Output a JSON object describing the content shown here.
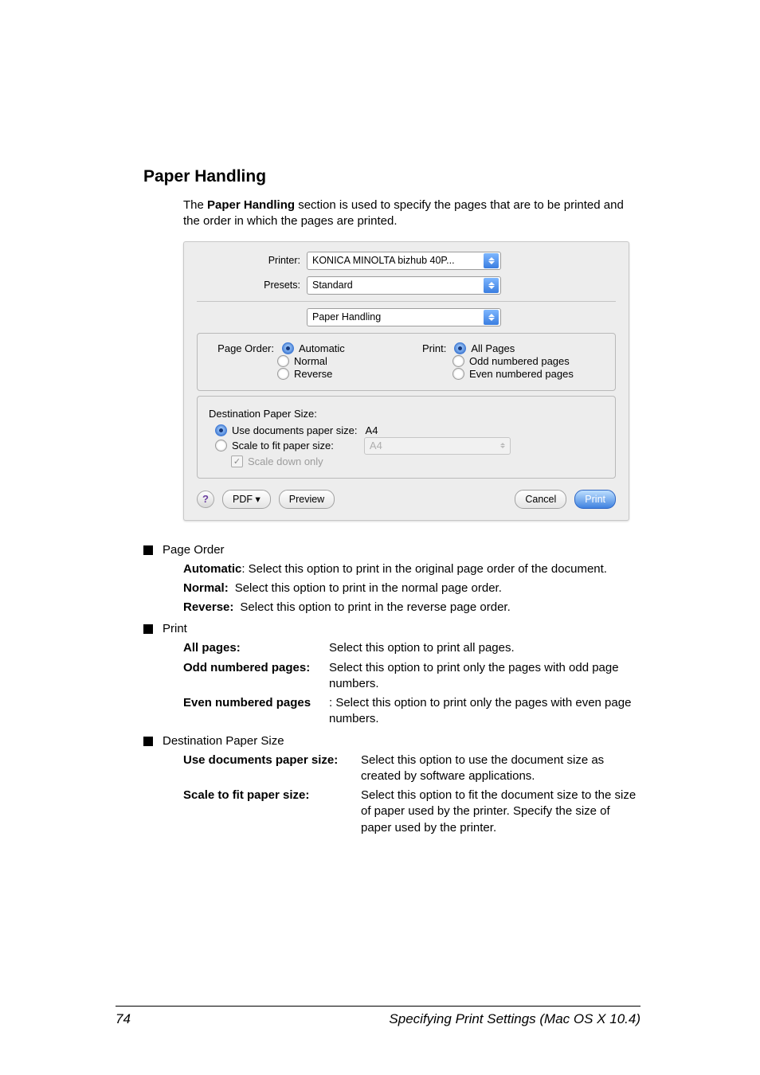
{
  "title": "Paper Handling",
  "intro_a": "The ",
  "intro_b": "Paper Handling",
  "intro_c": " section is used to specify the pages that are to be printed and the order in which the pages are printed.",
  "dialog": {
    "printer_label": "Printer:",
    "printer_value": "KONICA MINOLTA bizhub 40P...",
    "presets_label": "Presets:",
    "presets_value": "Standard",
    "section_value": "Paper Handling",
    "page_order_label": "Page Order:",
    "po_automatic": "Automatic",
    "po_normal": "Normal",
    "po_reverse": "Reverse",
    "print_label": "Print:",
    "pr_all": "All Pages",
    "pr_odd": "Odd numbered pages",
    "pr_even": "Even numbered pages",
    "dps_title": "Destination Paper Size:",
    "dps_use_label": "Use documents paper size:",
    "dps_use_value": "A4",
    "dps_scale_label": "Scale to fit paper size:",
    "dps_scale_value": "A4",
    "dps_scaledown": "Scale down only",
    "help_symbol": "?",
    "pdf_label": "PDF ▾",
    "preview_label": "Preview",
    "cancel_label": "Cancel",
    "print_btn_label": "Print"
  },
  "sections": {
    "page_order": {
      "title": "Page Order",
      "automatic_label": "Automatic",
      "automatic_text": ": Select this option to print in the original page order of the document.",
      "normal_label": "Normal",
      "normal_text": "Select this option to print in the normal page order.",
      "reverse_label": "Reverse",
      "reverse_text": "Select this option to print in the reverse page order."
    },
    "print": {
      "title": "Print",
      "all_label": "All pages",
      "all_text": "Select this option to print all pages.",
      "odd_label": "Odd numbered pages",
      "odd_text": "Select this option to print only the pages with odd page numbers.",
      "even_label": "Even numbered pages",
      "even_text": ": Select this option to print only the pages with even page numbers."
    },
    "dps": {
      "title": "Destination Paper Size",
      "use_label": "Use documents paper size",
      "use_text": "Select this option to use the document size as created by software applications.",
      "scale_label": "Scale to fit paper size",
      "scale_text": "Select this option to fit the document size to the size of paper used by the printer. Specify the size of paper used by the printer."
    }
  },
  "footer": {
    "page": "74",
    "text": "Specifying Print Settings (Mac OS X 10.4)"
  }
}
